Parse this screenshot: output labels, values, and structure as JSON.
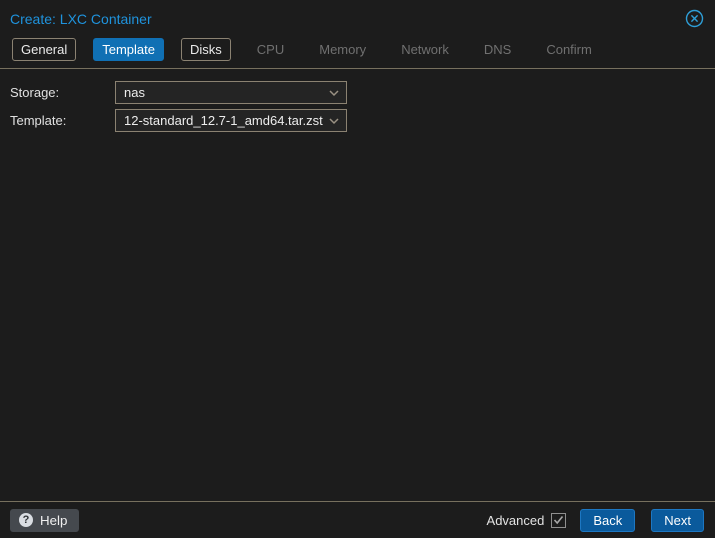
{
  "window": {
    "title": "Create: LXC Container"
  },
  "icons": {
    "close": "circle-x-icon",
    "help": "?",
    "dropdown": "chevron-down-icon",
    "advanced_check": "check-icon"
  },
  "tabs": [
    {
      "label": "General",
      "state": "enabled"
    },
    {
      "label": "Template",
      "state": "active"
    },
    {
      "label": "Disks",
      "state": "enabled"
    },
    {
      "label": "CPU",
      "state": "disabled"
    },
    {
      "label": "Memory",
      "state": "disabled"
    },
    {
      "label": "Network",
      "state": "disabled"
    },
    {
      "label": "DNS",
      "state": "disabled"
    },
    {
      "label": "Confirm",
      "state": "disabled"
    }
  ],
  "form": {
    "storage": {
      "label": "Storage:",
      "value": "nas"
    },
    "template": {
      "label": "Template:",
      "value": "12-standard_12.7-1_amd64.tar.zst"
    }
  },
  "footer": {
    "help_label": "Help",
    "advanced_label": "Advanced",
    "advanced_checked": true,
    "back_label": "Back",
    "next_label": "Next"
  },
  "colors": {
    "background": "#1c1c1c",
    "title_blue": "#1f93dd",
    "active_tab_blue": "#1070b4",
    "button_blue": "#0a5a9c",
    "button_border_blue": "#1d77c2",
    "border_tan": "#8b8272",
    "separator_tan": "#77705e",
    "disabled_text": "#707070"
  }
}
